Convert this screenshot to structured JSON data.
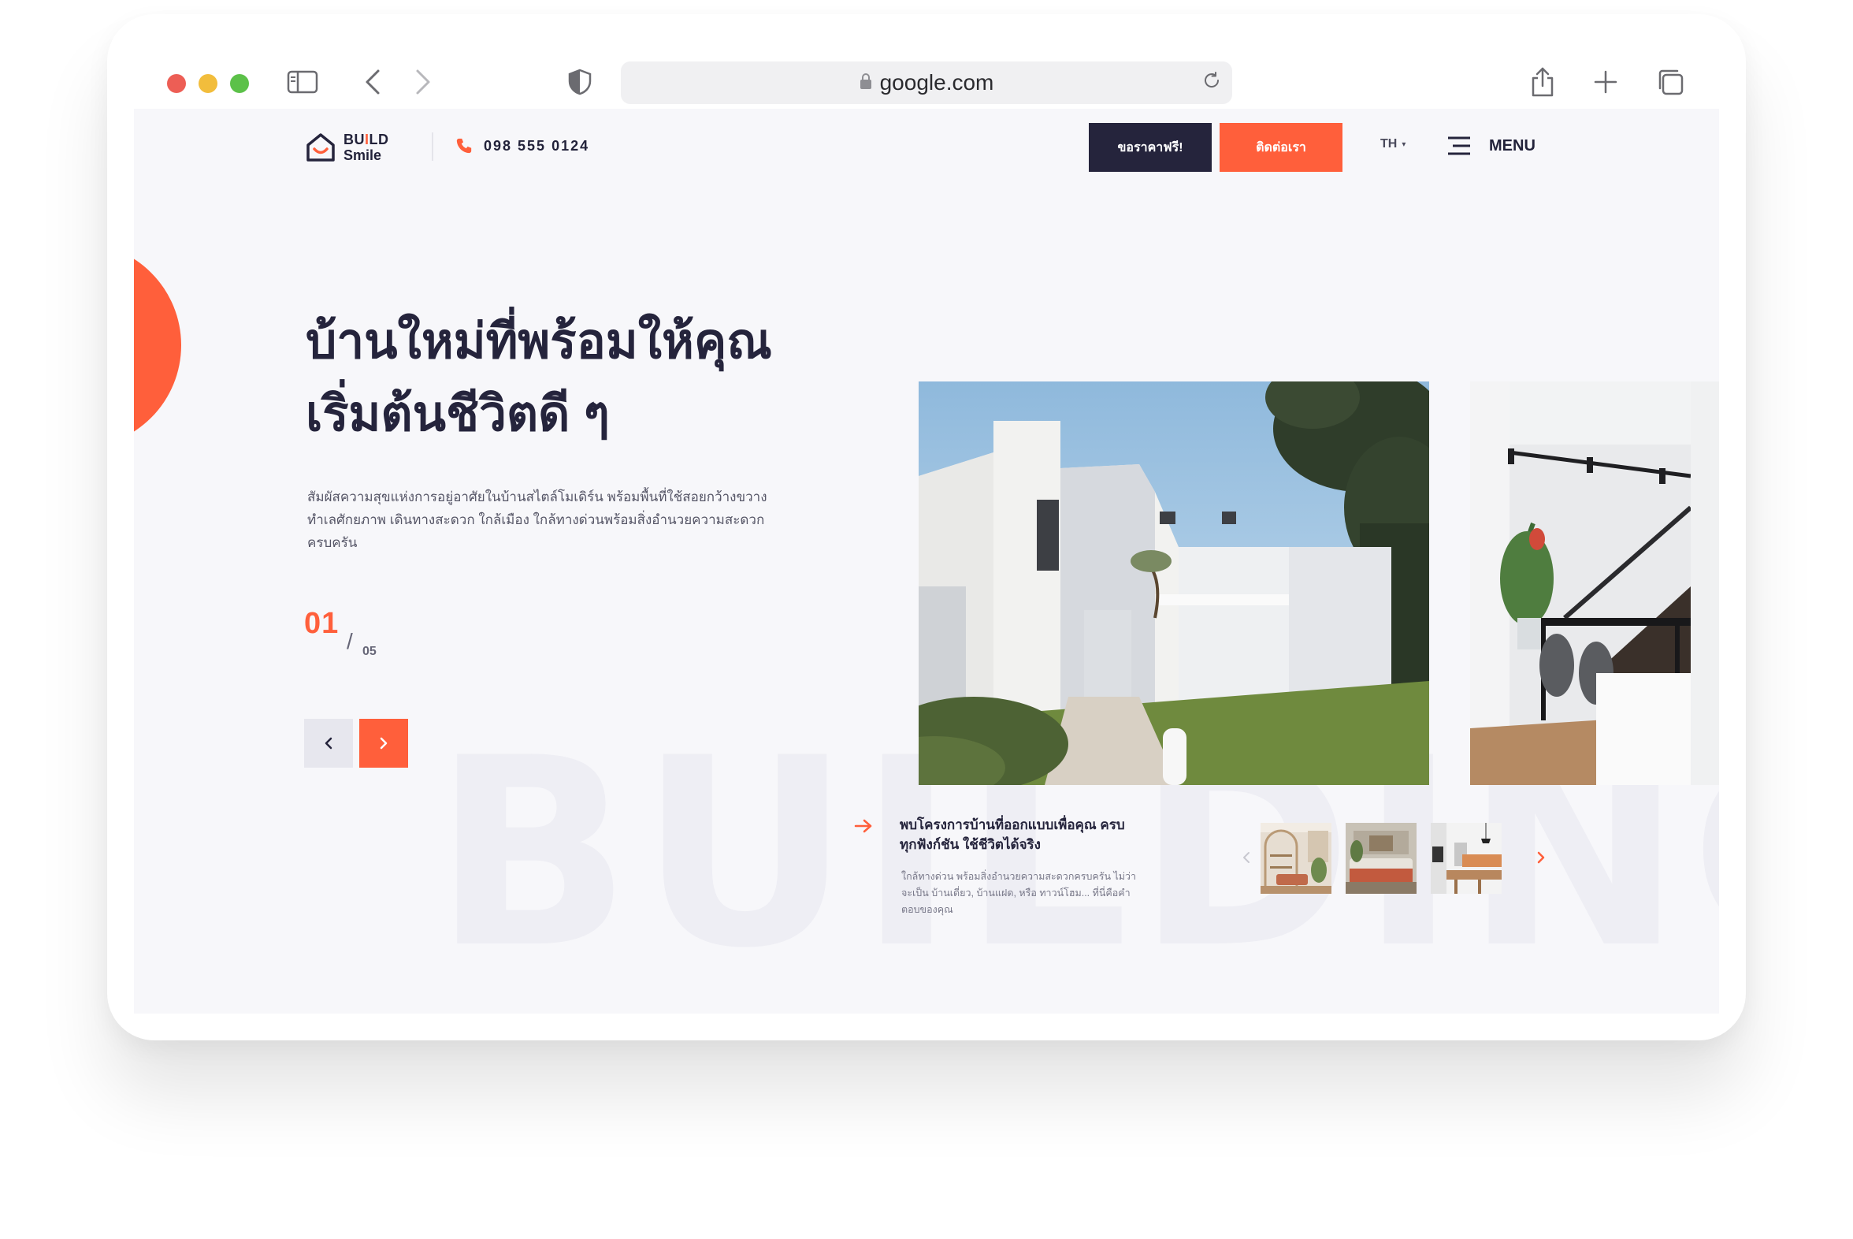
{
  "browser": {
    "url": "google.com"
  },
  "site": {
    "logo": {
      "line1_start": "BU",
      "line1_accent": "I",
      "line1_end": "LD",
      "line2": "Smile"
    },
    "phone": "098 555 0124",
    "nav": {
      "quote_button": "ขอราคาฟรี!",
      "contact_button": "ติดต่อเรา",
      "language": "TH",
      "menu_label": "MENU"
    }
  },
  "hero": {
    "title_line1": "บ้านใหม่ที่พร้อมให้คุณ",
    "title_line2": "เริ่มต้นชีวิตดี ๆ",
    "description": "สัมผัสความสุขแห่งการอยู่อาศัยในบ้านสไตล์โมเดิร์น พร้อมพื้นที่ใช้สอยกว้างขวาง ทำเลศักยภาพ เดินทางสะดวก ใกล้เมือง ใกล้ทางด่วนพร้อมสิ่งอำนวยความสะดวกครบครัน",
    "slide_current": "01",
    "slide_separator": "/",
    "slide_total": "05",
    "watermark": "BUILDING"
  },
  "project": {
    "title": "พบโครงการบ้านที่ออกแบบเพื่อคุณ ครบทุกฟังก์ชัน ใช้ชีวิตได้จริง",
    "description": "ใกล้ทางด่วน พร้อมสิ่งอำนวยความสะดวกครบครัน ไม่ว่าจะเป็น บ้านเดี่ยว, บ้านแฝด, หรือ ทาวน์โฮม... ที่นี่คือคำตอบของคุณ"
  },
  "colors": {
    "accent": "#ff5f3b",
    "dark": "#25243c",
    "background": "#f7f7fa"
  },
  "icons": {
    "lock": "lock-icon",
    "reload": "reload-icon",
    "phone": "phone-icon",
    "menu": "hamburger-icon",
    "arrow": "arrow-right-icon"
  }
}
